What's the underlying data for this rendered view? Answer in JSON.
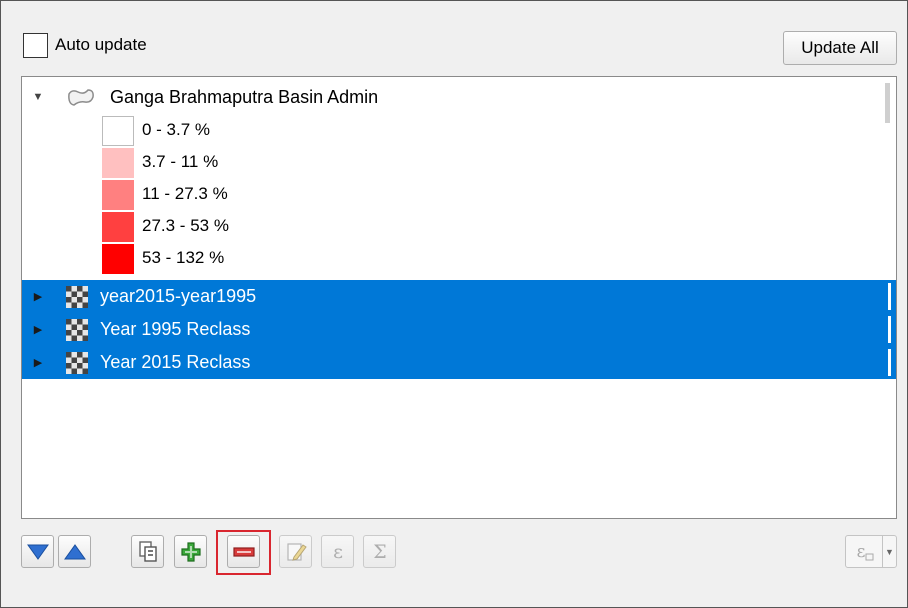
{
  "top": {
    "auto_update_label": "Auto update",
    "auto_update_checked": false,
    "update_all_label": "Update All"
  },
  "tree": {
    "root_layer": {
      "name": "Ganga Brahmaputra Basin Admin",
      "expanded": true,
      "icon": "polygon-layer-icon",
      "legend": [
        {
          "label": "0 - 3.7 %",
          "color": "#ffffff"
        },
        {
          "label": "3.7 - 11 %",
          "color": "#ffc0c0"
        },
        {
          "label": "11 - 27.3 %",
          "color": "#ff8080"
        },
        {
          "label": "27.3 - 53 %",
          "color": "#ff4040"
        },
        {
          "label": "53 - 132 %",
          "color": "#ff0000"
        }
      ]
    },
    "selected_layers": [
      {
        "name": "year2015-year1995",
        "icon": "raster-layer-icon"
      },
      {
        "name": "Year 1995 Reclass",
        "icon": "raster-layer-icon"
      },
      {
        "name": "Year 2015 Reclass",
        "icon": "raster-layer-icon"
      }
    ]
  },
  "toolbar": {
    "buttons": [
      {
        "name": "move-down-button",
        "icon": "triangle-down-icon",
        "enabled": true
      },
      {
        "name": "move-up-button",
        "icon": "triangle-up-icon",
        "enabled": true
      },
      {
        "name": "add-all-button",
        "icon": "copy-icon",
        "enabled": true
      },
      {
        "name": "add-button",
        "icon": "plus-icon",
        "enabled": true
      },
      {
        "name": "remove-button",
        "icon": "minus-icon",
        "enabled": true,
        "highlighted": true
      },
      {
        "name": "edit-button",
        "icon": "pencil-icon",
        "enabled": false
      },
      {
        "name": "expression-button",
        "icon": "epsilon-icon",
        "enabled": false
      },
      {
        "name": "count-button",
        "icon": "sigma-icon",
        "enabled": false
      }
    ],
    "expression_filter_icon": "filter-expression-icon"
  },
  "colors": {
    "selection": "#0078d7",
    "highlight_border": "#d9262f"
  }
}
